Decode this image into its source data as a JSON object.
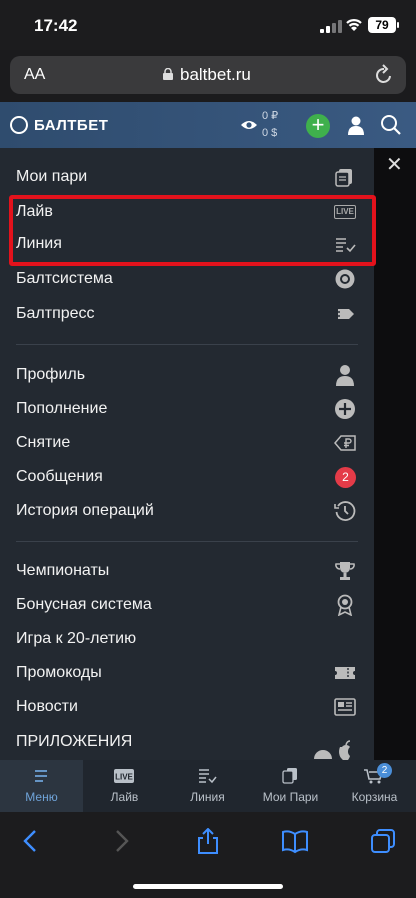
{
  "status": {
    "time": "17:42",
    "battery": "79"
  },
  "browser": {
    "aa": "AA",
    "url": "baltbet.ru"
  },
  "header": {
    "logo": "БАЛТБЕТ",
    "balance_rub": "0 ₽",
    "balance_bonus": "0 $"
  },
  "menu": {
    "group1": [
      "Мои пари",
      "Лайв",
      "Линия",
      "Балтсистема",
      "Балтпресс"
    ],
    "group2": [
      "Профиль",
      "Пополнение",
      "Снятие",
      "Сообщения",
      "История операций"
    ],
    "group3": [
      "Чемпионаты",
      "Бонусная система",
      "Игра к 20-летию",
      "Промокоды",
      "Новости",
      "ПРИЛОЖЕНИЯ"
    ],
    "live_badge": "LIVE",
    "messages_count": "2"
  },
  "tabs": [
    {
      "label": "Меню",
      "icon": "menu-icon"
    },
    {
      "label": "Лайв",
      "icon": "live-icon"
    },
    {
      "label": "Линия",
      "icon": "line-icon"
    },
    {
      "label": "Мои Пари",
      "icon": "bets-icon"
    },
    {
      "label": "Корзина",
      "icon": "cart-icon"
    }
  ],
  "cart_count": "2",
  "colors": {
    "accent_green": "#3fb04c",
    "highlight_red": "#e3121c",
    "badge_red": "#e43b48",
    "header_blue": "#34547a"
  }
}
